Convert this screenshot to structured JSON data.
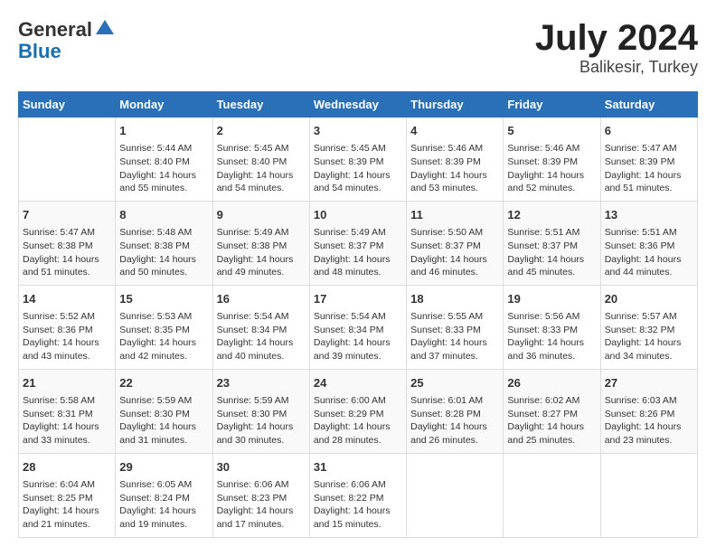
{
  "header": {
    "logo_line1": "General",
    "logo_line2": "Blue",
    "month_title": "July 2024",
    "subtitle": "Balikesir, Turkey"
  },
  "calendar": {
    "weekdays": [
      "Sunday",
      "Monday",
      "Tuesday",
      "Wednesday",
      "Thursday",
      "Friday",
      "Saturday"
    ],
    "weeks": [
      [
        {
          "day": "",
          "info": ""
        },
        {
          "day": "1",
          "info": "Sunrise: 5:44 AM\nSunset: 8:40 PM\nDaylight: 14 hours\nand 55 minutes."
        },
        {
          "day": "2",
          "info": "Sunrise: 5:45 AM\nSunset: 8:40 PM\nDaylight: 14 hours\nand 54 minutes."
        },
        {
          "day": "3",
          "info": "Sunrise: 5:45 AM\nSunset: 8:39 PM\nDaylight: 14 hours\nand 54 minutes."
        },
        {
          "day": "4",
          "info": "Sunrise: 5:46 AM\nSunset: 8:39 PM\nDaylight: 14 hours\nand 53 minutes."
        },
        {
          "day": "5",
          "info": "Sunrise: 5:46 AM\nSunset: 8:39 PM\nDaylight: 14 hours\nand 52 minutes."
        },
        {
          "day": "6",
          "info": "Sunrise: 5:47 AM\nSunset: 8:39 PM\nDaylight: 14 hours\nand 51 minutes."
        }
      ],
      [
        {
          "day": "7",
          "info": "Sunrise: 5:47 AM\nSunset: 8:38 PM\nDaylight: 14 hours\nand 51 minutes."
        },
        {
          "day": "8",
          "info": "Sunrise: 5:48 AM\nSunset: 8:38 PM\nDaylight: 14 hours\nand 50 minutes."
        },
        {
          "day": "9",
          "info": "Sunrise: 5:49 AM\nSunset: 8:38 PM\nDaylight: 14 hours\nand 49 minutes."
        },
        {
          "day": "10",
          "info": "Sunrise: 5:49 AM\nSunset: 8:37 PM\nDaylight: 14 hours\nand 48 minutes."
        },
        {
          "day": "11",
          "info": "Sunrise: 5:50 AM\nSunset: 8:37 PM\nDaylight: 14 hours\nand 46 minutes."
        },
        {
          "day": "12",
          "info": "Sunrise: 5:51 AM\nSunset: 8:37 PM\nDaylight: 14 hours\nand 45 minutes."
        },
        {
          "day": "13",
          "info": "Sunrise: 5:51 AM\nSunset: 8:36 PM\nDaylight: 14 hours\nand 44 minutes."
        }
      ],
      [
        {
          "day": "14",
          "info": "Sunrise: 5:52 AM\nSunset: 8:36 PM\nDaylight: 14 hours\nand 43 minutes."
        },
        {
          "day": "15",
          "info": "Sunrise: 5:53 AM\nSunset: 8:35 PM\nDaylight: 14 hours\nand 42 minutes."
        },
        {
          "day": "16",
          "info": "Sunrise: 5:54 AM\nSunset: 8:34 PM\nDaylight: 14 hours\nand 40 minutes."
        },
        {
          "day": "17",
          "info": "Sunrise: 5:54 AM\nSunset: 8:34 PM\nDaylight: 14 hours\nand 39 minutes."
        },
        {
          "day": "18",
          "info": "Sunrise: 5:55 AM\nSunset: 8:33 PM\nDaylight: 14 hours\nand 37 minutes."
        },
        {
          "day": "19",
          "info": "Sunrise: 5:56 AM\nSunset: 8:33 PM\nDaylight: 14 hours\nand 36 minutes."
        },
        {
          "day": "20",
          "info": "Sunrise: 5:57 AM\nSunset: 8:32 PM\nDaylight: 14 hours\nand 34 minutes."
        }
      ],
      [
        {
          "day": "21",
          "info": "Sunrise: 5:58 AM\nSunset: 8:31 PM\nDaylight: 14 hours\nand 33 minutes."
        },
        {
          "day": "22",
          "info": "Sunrise: 5:59 AM\nSunset: 8:30 PM\nDaylight: 14 hours\nand 31 minutes."
        },
        {
          "day": "23",
          "info": "Sunrise: 5:59 AM\nSunset: 8:30 PM\nDaylight: 14 hours\nand 30 minutes."
        },
        {
          "day": "24",
          "info": "Sunrise: 6:00 AM\nSunset: 8:29 PM\nDaylight: 14 hours\nand 28 minutes."
        },
        {
          "day": "25",
          "info": "Sunrise: 6:01 AM\nSunset: 8:28 PM\nDaylight: 14 hours\nand 26 minutes."
        },
        {
          "day": "26",
          "info": "Sunrise: 6:02 AM\nSunset: 8:27 PM\nDaylight: 14 hours\nand 25 minutes."
        },
        {
          "day": "27",
          "info": "Sunrise: 6:03 AM\nSunset: 8:26 PM\nDaylight: 14 hours\nand 23 minutes."
        }
      ],
      [
        {
          "day": "28",
          "info": "Sunrise: 6:04 AM\nSunset: 8:25 PM\nDaylight: 14 hours\nand 21 minutes."
        },
        {
          "day": "29",
          "info": "Sunrise: 6:05 AM\nSunset: 8:24 PM\nDaylight: 14 hours\nand 19 minutes."
        },
        {
          "day": "30",
          "info": "Sunrise: 6:06 AM\nSunset: 8:23 PM\nDaylight: 14 hours\nand 17 minutes."
        },
        {
          "day": "31",
          "info": "Sunrise: 6:06 AM\nSunset: 8:22 PM\nDaylight: 14 hours\nand 15 minutes."
        },
        {
          "day": "",
          "info": ""
        },
        {
          "day": "",
          "info": ""
        },
        {
          "day": "",
          "info": ""
        }
      ]
    ]
  }
}
